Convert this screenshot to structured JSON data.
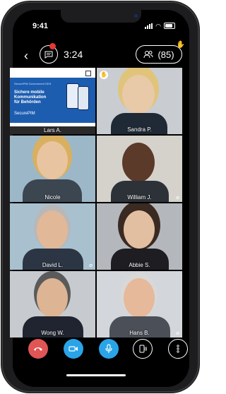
{
  "status_bar": {
    "time": "9:41"
  },
  "call_header": {
    "timer": "3:24",
    "participants_count": "(85)"
  },
  "tiles": [
    {
      "name": "Lars A.",
      "type": "screen-share",
      "share": {
        "headline": "Sichere mobile\nKommunikation\nfür Behörden",
        "brand": "SecurePIM",
        "small": "SecurePIM Government SDS"
      }
    },
    {
      "name": "Sandra P.",
      "hand_raised": true
    },
    {
      "name": "Nicole",
      "muted": false
    },
    {
      "name": "William J.",
      "muted": true
    },
    {
      "name": "David L.",
      "muted": true
    },
    {
      "name": "Abbie S.",
      "muted": false
    },
    {
      "name": "Wong W.",
      "muted": false
    },
    {
      "name": "Hans B.",
      "muted": true
    }
  ],
  "controls": [
    {
      "name": "end-call",
      "color": "#e05555"
    },
    {
      "name": "camera",
      "color": "#2aa4e8"
    },
    {
      "name": "microphone",
      "color": "#2aa4e8"
    },
    {
      "name": "audio-output",
      "color": "#000000"
    },
    {
      "name": "more-options",
      "color": "#000000"
    }
  ]
}
